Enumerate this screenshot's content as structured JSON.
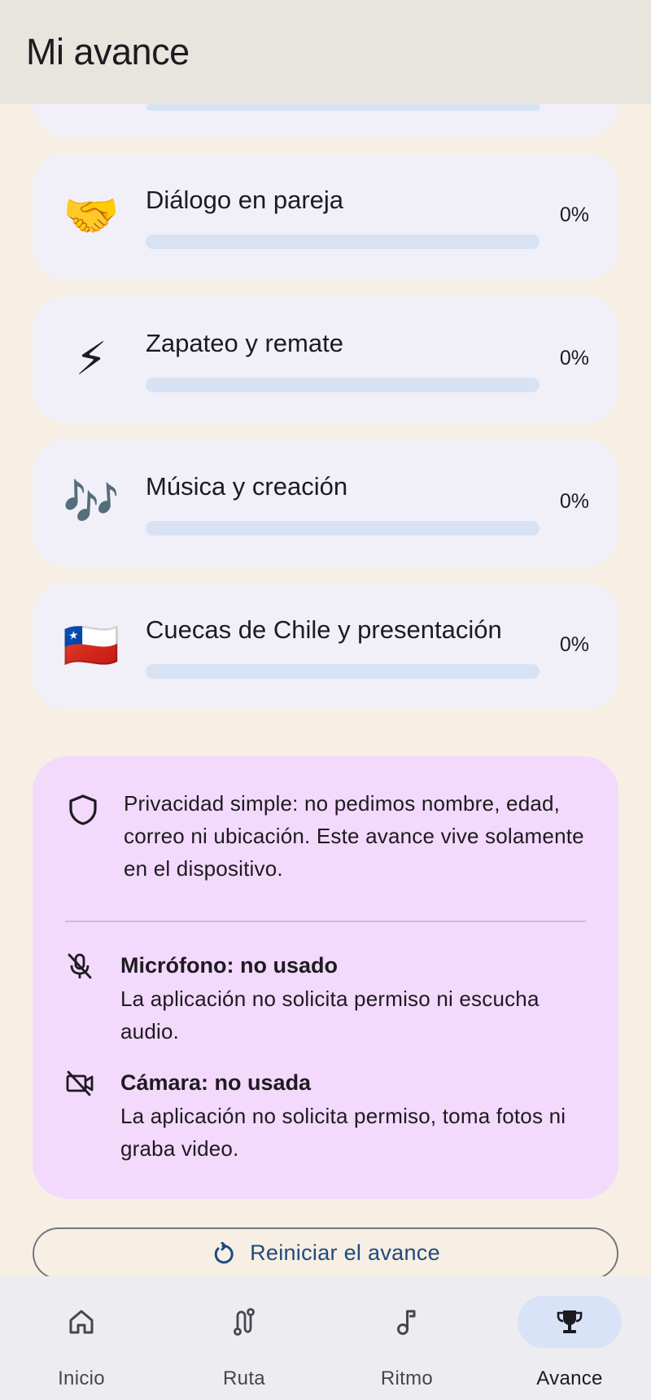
{
  "app_bar": {
    "title": "Mi avance"
  },
  "topics": [
    {
      "icon": "handshake-icon",
      "emoji": "🤝",
      "title": "Diálogo en pareja",
      "percent_label": "0%",
      "progress": 0
    },
    {
      "icon": "lightning-icon",
      "emoji": "⚡",
      "title": "Zapateo y remate",
      "percent_label": "0%",
      "progress": 0
    },
    {
      "icon": "music-notes-icon",
      "emoji": "🎶",
      "title": "Música y creación",
      "percent_label": "0%",
      "progress": 0
    },
    {
      "icon": "chile-flag-icon",
      "emoji": "🇨🇱",
      "title": "Cuecas de Chile y presentación",
      "percent_label": "0%",
      "progress": 0
    }
  ],
  "privacy": {
    "intro": "Privacidad simple: no pedimos nombre, edad, correo ni ubicación. Este avance vive solamente en el dispositivo.",
    "microphone": {
      "title": "Micrófono: no usado",
      "description": "La aplicación no solicita permiso ni escucha audio."
    },
    "camera": {
      "title": "Cámara: no usada",
      "description": "La aplicación no solicita permiso, toma fotos ni graba video."
    }
  },
  "reset_button": {
    "label": "Reiniciar el avance"
  },
  "nav": {
    "items": [
      {
        "label": "Inicio",
        "icon": "home-icon",
        "active": false
      },
      {
        "label": "Ruta",
        "icon": "route-icon",
        "active": false
      },
      {
        "label": "Ritmo",
        "icon": "music-note-icon",
        "active": false
      },
      {
        "label": "Avance",
        "icon": "trophy-icon",
        "active": true
      }
    ]
  },
  "colors": {
    "background": "#f7efe4",
    "card": "#f1f0f8",
    "progress_track": "#d7e3f4",
    "privacy_card": "#f3d9fc",
    "nav_active_pill": "#d9e3f7",
    "button_text": "#1f4a7d"
  }
}
